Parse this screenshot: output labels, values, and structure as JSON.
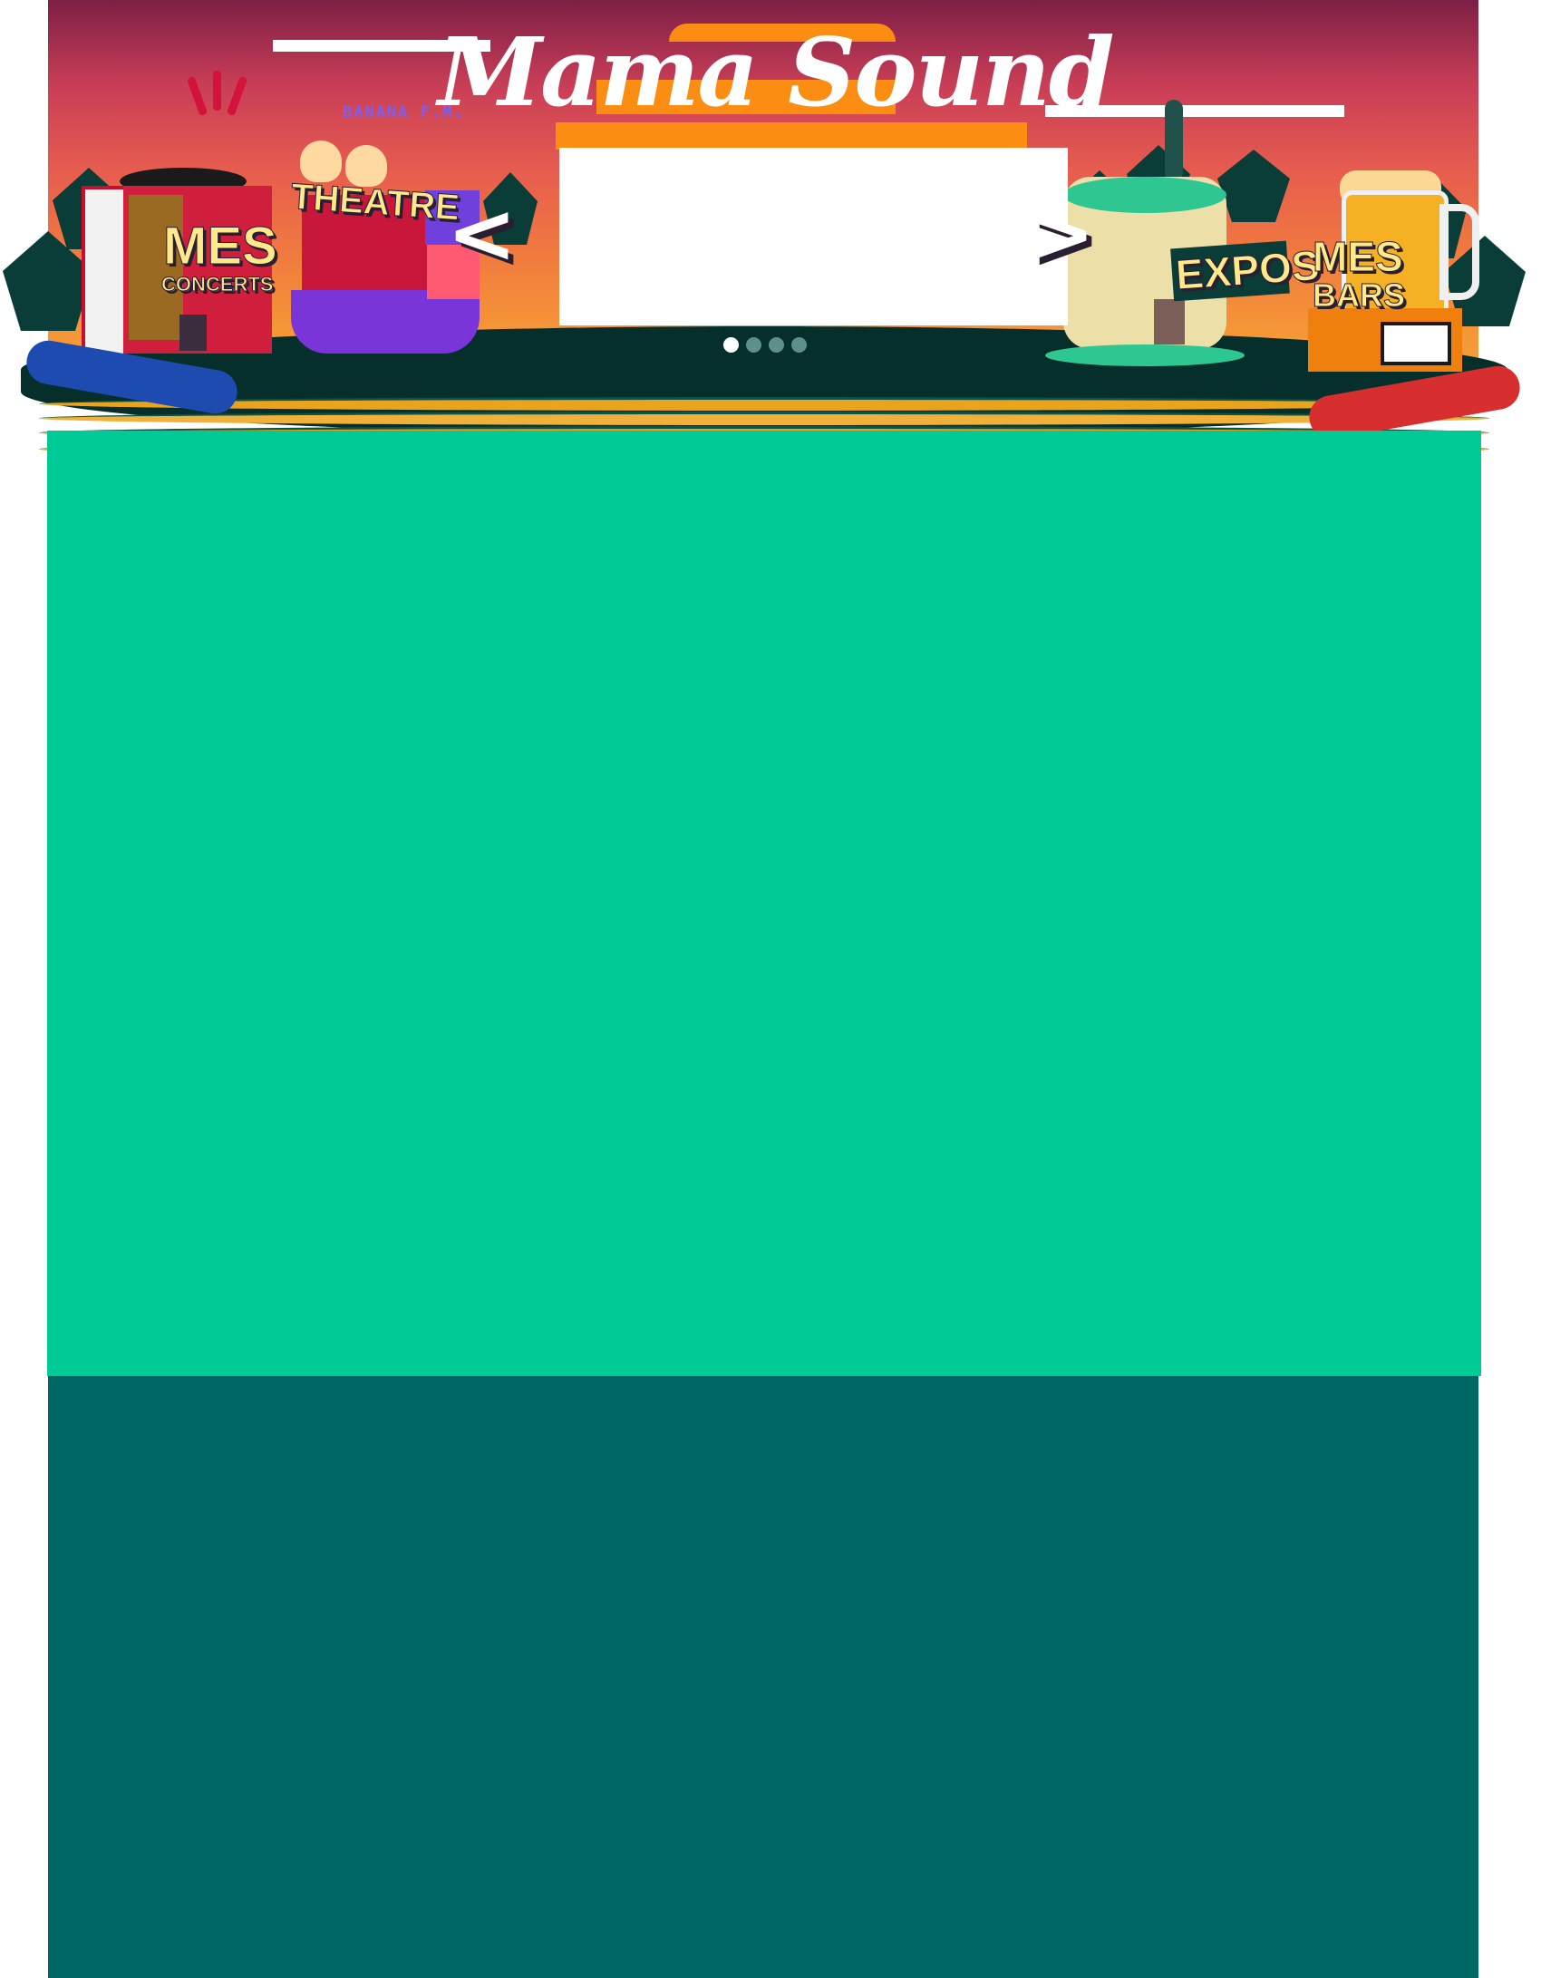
{
  "brand": {
    "logo_text": "Mama Sound",
    "logo_subtext": "BANANA F.M.",
    "colors": {
      "sky_top": "#7d1f45",
      "sky_bottom": "#f5a43a",
      "sun": "#fb8d12",
      "ground": "#062f2b",
      "content_green": "#00cb97",
      "footer_teal": "#006864"
    }
  },
  "nav": {
    "concerts": {
      "line1": "MES",
      "line2": "CONCERTS",
      "icon": "turntable-building-icon"
    },
    "theatre": {
      "label": "THEATRE",
      "icon": "cats-theatre-icon"
    },
    "expos": {
      "label": "EXPOS",
      "icon": "paint-can-icon"
    },
    "bars": {
      "line1": "MES",
      "line2": "BARS",
      "icon": "beer-mug-icon"
    }
  },
  "slider": {
    "prev_label": "<",
    "next_label": ">",
    "slide_count": 4,
    "active_index": 0
  }
}
